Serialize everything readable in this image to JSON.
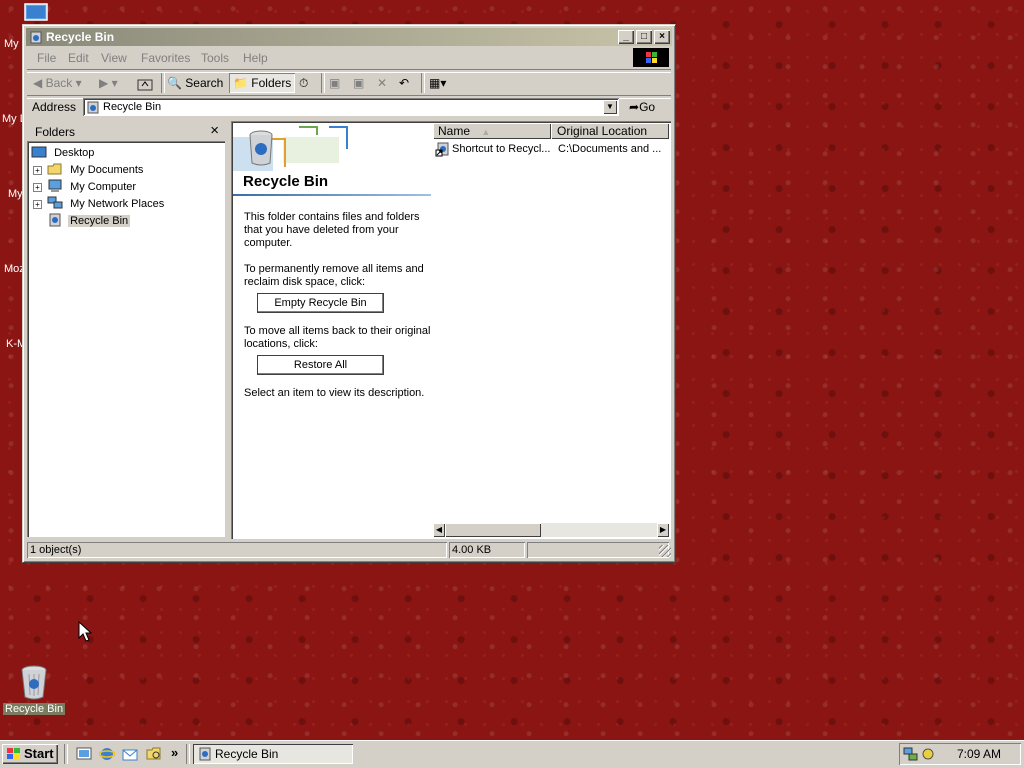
{
  "desktop": {
    "top_icon": "computer-icon",
    "left_labels": [
      "My",
      "My D",
      "My",
      "Moz",
      "K-M"
    ],
    "recycle_bin_label": "Recycle Bin"
  },
  "window": {
    "title": "Recycle Bin",
    "controls": {
      "minimize": "_",
      "maximize": "□",
      "close": "×"
    },
    "menu": [
      "File",
      "Edit",
      "View",
      "Favorites",
      "Tools",
      "Help"
    ],
    "toolbar": {
      "back": "Back",
      "search": "Search",
      "folders": "Folders"
    },
    "address": {
      "label": "Address",
      "value": "Recycle Bin",
      "go": "Go"
    },
    "folders_pane": {
      "title": "Folders",
      "close": "×",
      "items": [
        {
          "label": "Desktop"
        },
        {
          "label": "My Documents"
        },
        {
          "label": "My Computer"
        },
        {
          "label": "My Network Places"
        },
        {
          "label": "Recycle Bin"
        }
      ]
    },
    "webview": {
      "heading": "Recycle Bin",
      "para1": "This folder contains files and folders that you have deleted from your computer.",
      "para2": "To permanently remove all items and reclaim disk space, click:",
      "empty_button": "Empty Recycle Bin",
      "para3": "To move all items back to their original locations, click:",
      "restore_button": "Restore All",
      "para4": "Select an item to view its description."
    },
    "list": {
      "columns": [
        "Name",
        "Original Location"
      ],
      "rows": [
        {
          "name": "Shortcut to Recycl...",
          "location": "C:\\Documents and ..."
        }
      ]
    },
    "status": {
      "objects": "1 object(s)",
      "size": "4.00 KB"
    }
  },
  "taskbar": {
    "start": "Start",
    "more": "»",
    "task": "Recycle Bin",
    "time": "7:09 AM"
  }
}
